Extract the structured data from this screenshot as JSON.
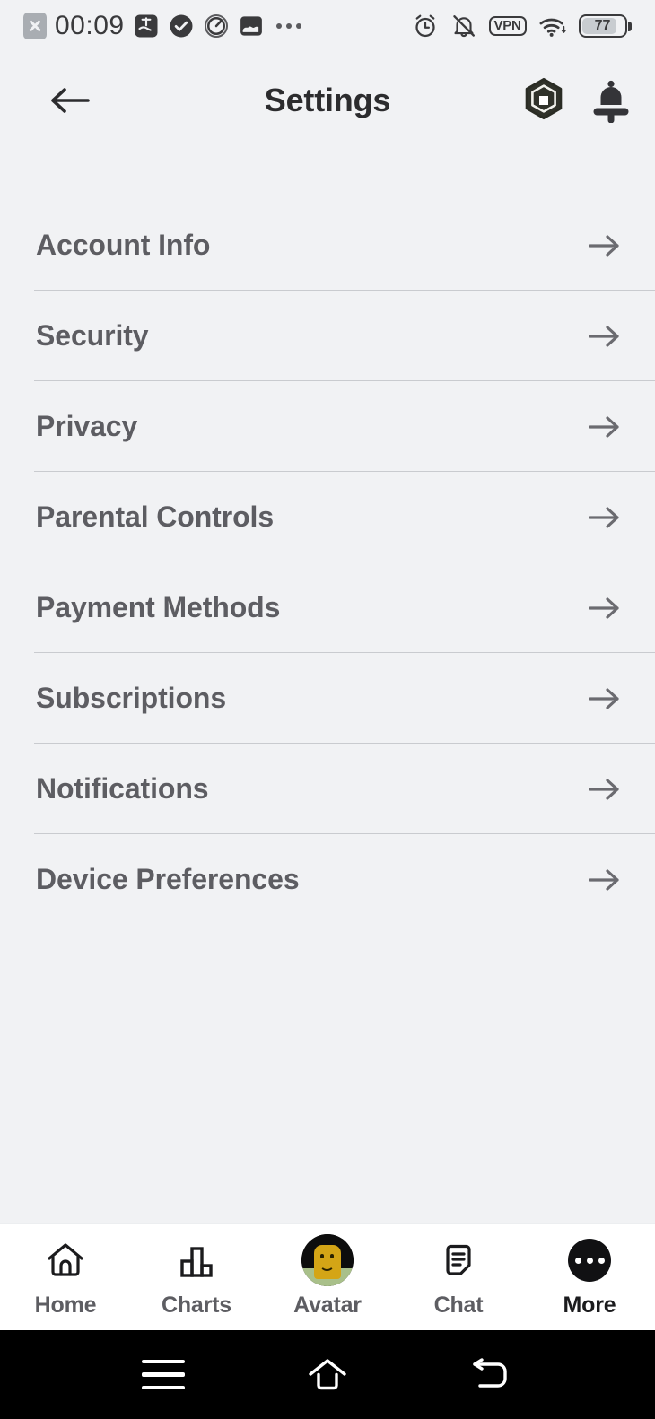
{
  "status_bar": {
    "time": "00:09",
    "sim_icon": "sim-disabled-icon",
    "left_icons": [
      "alipay-icon",
      "check-circle-icon",
      "speedometer-icon",
      "photo-icon",
      "more-dots-icon"
    ],
    "right_icons": [
      "alarm-clock-icon",
      "bell-muted-icon",
      "vpn-badge",
      "wifi-icon",
      "battery-icon"
    ],
    "vpn_label": "VPN",
    "battery_level": "77"
  },
  "header": {
    "title": "Settings",
    "back_icon": "arrow-left-icon",
    "robux_icon": "robux-hexagon-icon",
    "bell_icon": "bell-icon"
  },
  "settings": {
    "rows": [
      {
        "label": "Account Info",
        "arrow": "arrow-right-icon"
      },
      {
        "label": "Security",
        "arrow": "arrow-right-icon"
      },
      {
        "label": "Privacy",
        "arrow": "arrow-right-icon"
      },
      {
        "label": "Parental Controls",
        "arrow": "arrow-right-icon"
      },
      {
        "label": "Payment Methods",
        "arrow": "arrow-right-icon"
      },
      {
        "label": "Subscriptions",
        "arrow": "arrow-right-icon"
      },
      {
        "label": "Notifications",
        "arrow": "arrow-right-icon"
      },
      {
        "label": "Device Preferences",
        "arrow": "arrow-right-icon"
      }
    ]
  },
  "bottom_nav": {
    "items": [
      {
        "label": "Home",
        "icon": "home-icon",
        "active": false
      },
      {
        "label": "Charts",
        "icon": "bar-chart-icon",
        "active": false
      },
      {
        "label": "Avatar",
        "icon": "avatar-icon",
        "active": false
      },
      {
        "label": "Chat",
        "icon": "chat-document-icon",
        "active": false
      },
      {
        "label": "More",
        "icon": "more-dots-icon",
        "active": true
      }
    ]
  },
  "android_nav": {
    "recents_icon": "menu-icon",
    "home_icon": "home-outline-icon",
    "back_icon": "back-arrow-icon"
  },
  "colors": {
    "page_background": "#f1f2f4",
    "nav_background": "#ffffff",
    "text_primary": "#2c2c2e",
    "text_secondary": "#5d5d62",
    "divider": "#c9cbcf",
    "system_nav": "#000000"
  }
}
